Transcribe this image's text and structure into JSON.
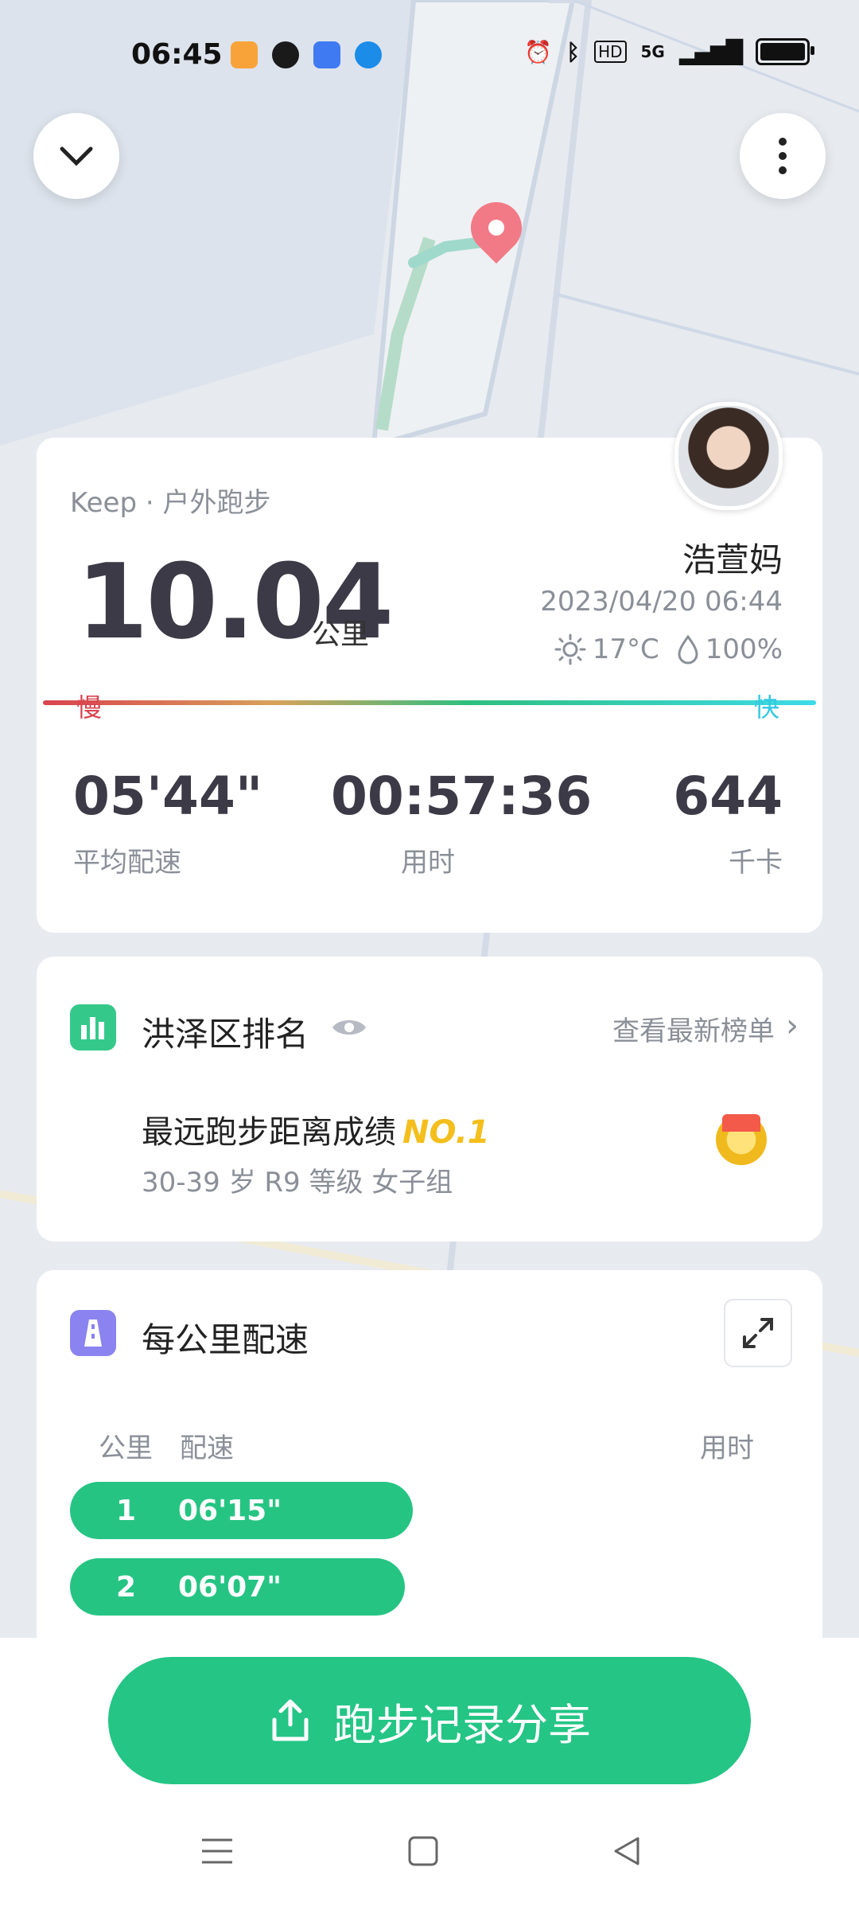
{
  "status_bar": {
    "time": "06:45",
    "network": "5G"
  },
  "summary": {
    "source": "Keep · 户外跑步",
    "distance": "10.04",
    "distance_unit": "公里",
    "user_name": "浩萱妈",
    "datetime": "2023/04/20 06:44",
    "temperature": "17°C",
    "humidity": "100%",
    "slow_label": "慢",
    "fast_label": "快",
    "stats": [
      {
        "value": "05'44\"",
        "label": "平均配速"
      },
      {
        "value": "00:57:36",
        "label": "用时"
      },
      {
        "value": "644",
        "label": "千卡"
      }
    ]
  },
  "ranking": {
    "title": "洪泽区排名",
    "link": "查看最新榜单",
    "achievement": "最远跑步距离成绩",
    "rank": "NO.1",
    "group": "30-39 岁 R9 等级 女子组"
  },
  "splits": {
    "title": "每公里配速",
    "headers": {
      "km": "公里",
      "pace": "配速",
      "time": "用时"
    },
    "rows": [
      {
        "km": "1",
        "pace": "06'15\"",
        "bar_fraction": 0.44
      },
      {
        "km": "2",
        "pace": "06'07\"",
        "bar_fraction": 0.43
      }
    ]
  },
  "share_button": {
    "label": "跑步记录分享"
  },
  "colors": {
    "accent": "#24c585",
    "slow": "#d9434f",
    "fast": "#34c8e2",
    "rank_gold": "#f4be1c"
  }
}
